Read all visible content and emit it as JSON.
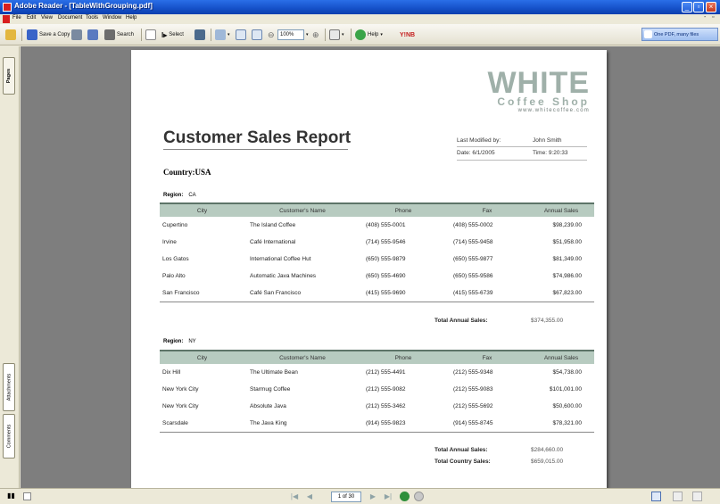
{
  "window": {
    "title": "Adobe Reader - [TableWithGrouping.pdf]",
    "minimize": "_",
    "restore": "▫",
    "close": "×"
  },
  "menu": [
    "File",
    "Edit",
    "View",
    "Document",
    "Tools",
    "Window",
    "Help"
  ],
  "mdi": {
    "minimize": "-",
    "restore": "▫"
  },
  "toolbar": {
    "save_copy": "Save a Copy",
    "search": "Search",
    "select": "Select",
    "zoom": "100%",
    "help": "Help",
    "ynb": "Y!NB",
    "promo": "One PDF, many files"
  },
  "nav_tabs": {
    "pages": "Pages",
    "attachments": "Attachments",
    "comments": "Comments"
  },
  "logo": {
    "line1": "WHITE",
    "line2": "Coffee Shop",
    "line3": "www.whitecoffee.com"
  },
  "report": {
    "title": "Customer Sales Report",
    "last_modified_label": "Last Modified by:",
    "last_modified_value": "John Smith",
    "date": "Date: 6/1/2005",
    "time": "Time: 9:20:33",
    "country": "Country:USA",
    "headers": [
      "City",
      "Customer's Name",
      "Phone",
      "Fax",
      "Annual Sales"
    ],
    "region_label": "Region:",
    "regions": [
      {
        "name": "CA",
        "rows": [
          [
            "Cupertino",
            "The Island Coffee",
            "(408) 555-0001",
            "(408) 555-0002",
            "$98,239.00"
          ],
          [
            "Irvine",
            "Café International",
            "(714) 555-9546",
            "(714) 555-9458",
            "$51,958.00"
          ],
          [
            "Los Gatos",
            "International Coffee Hut",
            "(650) 555-9879",
            "(650) 555-9877",
            "$81,349.00"
          ],
          [
            "Palo Alto",
            "Automatic Java Machines",
            "(650) 555-4690",
            "(650) 555-9586",
            "$74,986.00"
          ],
          [
            "San Francisco",
            "Café San Francisco",
            "(415) 555-9690",
            "(415) 555-6739",
            "$67,823.00"
          ]
        ],
        "total_label": "Total Annual Sales:",
        "total_value": "$374,355.00"
      },
      {
        "name": "NY",
        "rows": [
          [
            "Dix Hill",
            "The Ultimate Bean",
            "(212) 555-4491",
            "(212) 555-9348",
            "$54,738.00"
          ],
          [
            "New York City",
            "Starmug Coffee",
            "(212) 555-9082",
            "(212) 555-9083",
            "$101,001.00"
          ],
          [
            "New York City",
            "Absolute Java",
            "(212) 555-3462",
            "(212) 555-5692",
            "$50,600.00"
          ],
          [
            "Scarsdale",
            "The Java King",
            "(914) 555-9823",
            "(914) 555-8745",
            "$78,321.00"
          ]
        ],
        "total_label": "Total Annual Sales:",
        "total_value": "$284,660.00"
      }
    ],
    "country_total_label": "Total Country Sales:",
    "country_total_value": "$659,015.00"
  },
  "status": {
    "page_indicator": "1 of 30",
    "first": "|◀",
    "prev": "◀",
    "next": "▶",
    "last": "▶|"
  }
}
